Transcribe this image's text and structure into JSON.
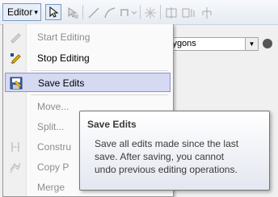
{
  "toolbar": {
    "editor_label": "Editor",
    "caret": "▾",
    "icons": [
      "edit-tool-icon",
      "annotation-tool-icon",
      "straight-segment-icon",
      "end-point-arc-icon",
      "trace-icon",
      "midpoint-icon",
      "split-tool-icon",
      "rotate-tool-icon",
      "attributes-icon"
    ]
  },
  "background": {
    "layer_select_value": "lygons",
    "dropdown_arrow": "▼"
  },
  "menu": {
    "items": [
      {
        "label": "Start Editing",
        "enabled": false,
        "icon": "pencil-icon"
      },
      {
        "label": "Stop Editing",
        "enabled": true,
        "icon": "pencil-stop-icon"
      },
      {
        "label": "Save Edits",
        "enabled": true,
        "highlighted": true,
        "icon": "save-edits-icon"
      },
      {
        "label": "Move...",
        "enabled": false
      },
      {
        "label": "Split...",
        "enabled": false
      },
      {
        "label": "Constru",
        "enabled": false,
        "icon": "construct-points-icon"
      },
      {
        "label": "Copy P",
        "enabled": false,
        "icon": "copy-parallel-icon"
      },
      {
        "label": "Merge",
        "enabled": false
      }
    ]
  },
  "tooltip": {
    "title": "Save Edits",
    "lines": [
      "Save all edits made since the last",
      "save. After saving, you cannot",
      "undo previous editing operations."
    ]
  },
  "colors": {
    "highlight_bg": "#d5d9f2",
    "highlight_border": "#8d95c9",
    "disabled_text": "#8d8d8d"
  }
}
